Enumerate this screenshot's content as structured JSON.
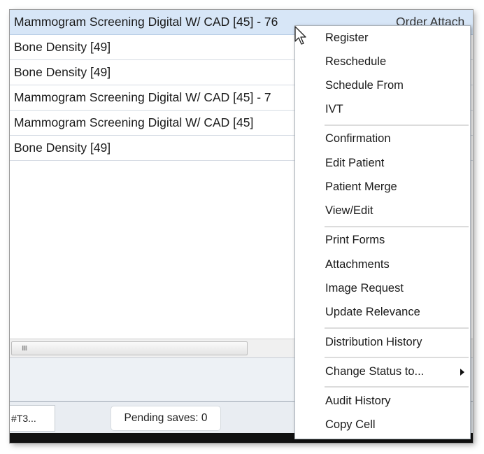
{
  "grid": {
    "rows": [
      {
        "text": "Mammogram Screening Digital W/ CAD [45] - 76",
        "extra": "Order Attach"
      },
      {
        "text": "Bone Density [49]"
      },
      {
        "text": "Bone Density [49]"
      },
      {
        "text": "Mammogram Screening Digital W/ CAD [45] - 7"
      },
      {
        "text": "Mammogram Screening Digital W/ CAD [45]"
      },
      {
        "text": "Bone Density [49]"
      }
    ],
    "scroll_grip": "IIII"
  },
  "status": {
    "tab_text": "#T3...",
    "pending_saves": "Pending saves: 0"
  },
  "context_menu": {
    "items": [
      "Register",
      "Reschedule",
      "Schedule From",
      "IVT",
      "Confirmation",
      "Edit Patient",
      "Patient Merge",
      "View/Edit",
      "Print Forms",
      "Attachments",
      "Image Request",
      "Update Relevance",
      "Distribution History",
      "Change Status to...",
      "Audit History",
      "Copy Cell"
    ]
  }
}
